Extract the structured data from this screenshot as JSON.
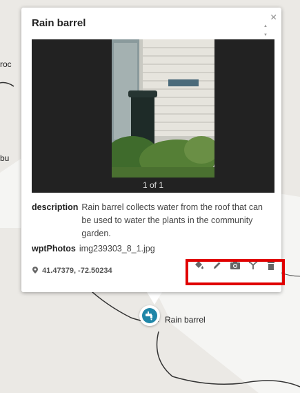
{
  "popup": {
    "title": "Rain barrel",
    "close_glyph": "×",
    "scroll_up_glyph": "▲",
    "scroll_down_glyph": "▼",
    "photo_counter": "1 of 1",
    "fields": [
      {
        "key": "description",
        "value": "Rain barrel collects water from the roof that can be used to water the plants in the community garden."
      },
      {
        "key": "wptPhotos",
        "value": "img239303_8_1.jpg"
      }
    ],
    "coordinates": "41.47379, -72.50234",
    "toolbar": [
      {
        "name": "style-icon",
        "title": "Style"
      },
      {
        "name": "edit-icon",
        "title": "Edit"
      },
      {
        "name": "camera-icon",
        "title": "Add photo"
      },
      {
        "name": "fork-icon",
        "title": "Directions"
      },
      {
        "name": "delete-icon",
        "title": "Delete"
      }
    ],
    "highlight_color": "#e00000"
  },
  "map": {
    "partial_label_1": "roc",
    "partial_label_2": "bu",
    "marker_label": "Rain barrel",
    "marker_color": "#1f86a8"
  }
}
